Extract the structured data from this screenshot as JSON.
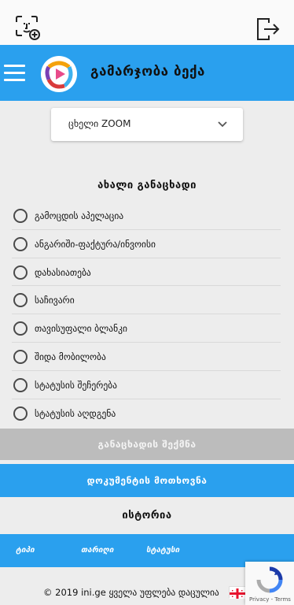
{
  "topbar": {
    "face_scan_icon": "face-scan-add-icon",
    "logout_icon": "logout-icon"
  },
  "header": {
    "greeting": "გამარჯობა  ბექა",
    "logo_icon": "app-logo"
  },
  "zoom_select": {
    "value": "ცხელი ZOOM"
  },
  "new_request": {
    "title": "ახალი განაცხადი",
    "options": [
      "გამოცდის აპელაცია",
      "ანგარიში-ფაქტურა/ინვოისი",
      "დახასიათება",
      "საჩივარი",
      "თავისუფალი ბლანკი",
      "შიდა მობილობა",
      "სტატუსის შეჩერება",
      "სტატუსის აღდგენა"
    ]
  },
  "buttons": {
    "create": "განაცხადის შექმნა",
    "request_document": "დოკუმენტის მოთხოვნა"
  },
  "history": {
    "title": "ისტორია",
    "columns": [
      "ტიპი",
      "თარიღი",
      "სტატუსი"
    ]
  },
  "footer": {
    "copyright": "© 2019 ini.ge ყველა უფლება დაცულია"
  },
  "recaptcha": {
    "text": "Privacy - Terms"
  },
  "colors": {
    "accent": "#2aa0ee",
    "disabled": "#bcbcbc"
  }
}
